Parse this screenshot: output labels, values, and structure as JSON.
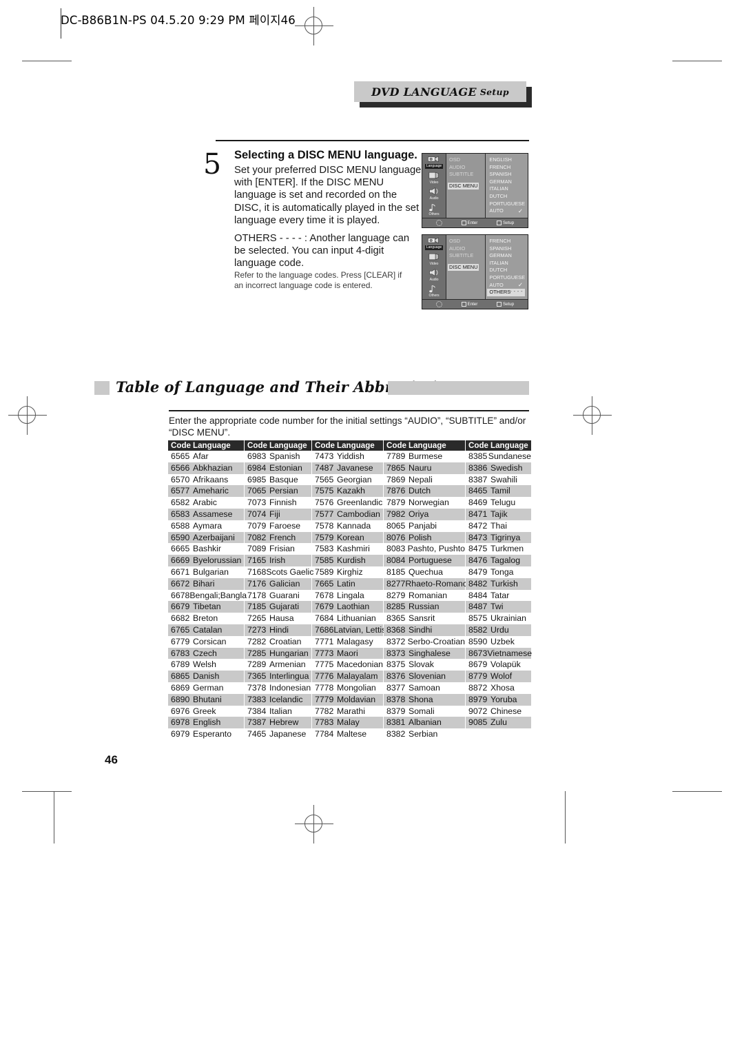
{
  "print_header": {
    "text": "DC-B86B1N-PS  04.5.20 9:29 PM  페이지46"
  },
  "banner": {
    "main": "DVD LANGUAGE",
    "small": "Setup"
  },
  "step": {
    "number": "5",
    "title": "Selecting a DISC MENU language.",
    "body": "Set your preferred DISC MENU language with [ENTER]. If the DISC MENU language is set and recorded on the DISC, it is automatically played in the set language every time it is played.",
    "others_body": "OTHERS - - - - : Another language can be selected. You can input 4-digit language code.",
    "others_note": "Refer to the language codes. Press [CLEAR] if an incorrect language code is entered."
  },
  "osd_screens": [
    {
      "rail": [
        {
          "label": "Language",
          "icon": "camcorder-icon",
          "active": true
        },
        {
          "label": "Video",
          "icon": "film-icon",
          "active": false
        },
        {
          "label": "Audio",
          "icon": "speaker-icon",
          "active": false
        },
        {
          "label": "Others",
          "icon": "note-icon",
          "active": false
        }
      ],
      "middle": [
        {
          "label": "OSD",
          "selected": false
        },
        {
          "label": "AUDIO",
          "selected": false
        },
        {
          "label": "SUBTITLE",
          "selected": false
        },
        {
          "label": "DISC MENU",
          "selected": true
        }
      ],
      "right": [
        {
          "label": "ENGLISH",
          "mark": "",
          "highlight": false
        },
        {
          "label": "FRENCH",
          "mark": "",
          "highlight": false
        },
        {
          "label": "SPANISH",
          "mark": "",
          "highlight": false
        },
        {
          "label": "GERMAN",
          "mark": "",
          "highlight": false
        },
        {
          "label": "ITALIAN",
          "mark": "",
          "highlight": false
        },
        {
          "label": "DUTCH",
          "mark": "",
          "highlight": false
        },
        {
          "label": "PORTUGUESE",
          "mark": "",
          "highlight": false
        },
        {
          "label": "AUTO",
          "mark": "check",
          "highlight": false
        }
      ],
      "footer": {
        "enter": "Enter",
        "setup": "Setup"
      }
    },
    {
      "rail": [
        {
          "label": "Language",
          "icon": "camcorder-icon",
          "active": true
        },
        {
          "label": "Video",
          "icon": "film-icon",
          "active": false
        },
        {
          "label": "Audio",
          "icon": "speaker-icon",
          "active": false
        },
        {
          "label": "Others",
          "icon": "note-icon",
          "active": false
        }
      ],
      "middle": [
        {
          "label": "OSD",
          "selected": false
        },
        {
          "label": "AUDIO",
          "selected": false
        },
        {
          "label": "SUBTITLE",
          "selected": false
        },
        {
          "label": "DISC MENU",
          "selected": true
        }
      ],
      "right": [
        {
          "label": "FRENCH",
          "mark": "",
          "highlight": false
        },
        {
          "label": "SPANISH",
          "mark": "",
          "highlight": false
        },
        {
          "label": "GERMAN",
          "mark": "",
          "highlight": false
        },
        {
          "label": "ITALIAN",
          "mark": "",
          "highlight": false
        },
        {
          "label": "DUTCH",
          "mark": "",
          "highlight": false
        },
        {
          "label": "PORTUGUESE",
          "mark": "",
          "highlight": false
        },
        {
          "label": "AUTO",
          "mark": "check",
          "highlight": false
        },
        {
          "label": "OTHERS",
          "mark": "dashes",
          "highlight": true
        }
      ],
      "footer": {
        "enter": "Enter",
        "setup": "Setup"
      }
    }
  ],
  "section": {
    "title": "Table of Language and Their Abbreviations",
    "intro": "Enter the appropriate code number for the initial settings “AUDIO”, “SUBTITLE” and/or “DISC MENU”."
  },
  "table": {
    "headers": [
      "Code",
      "Language"
    ],
    "columns": [
      [
        [
          "6565",
          "Afar"
        ],
        [
          "6566",
          "Abkhazian"
        ],
        [
          "6570",
          "Afrikaans"
        ],
        [
          "6577",
          "Ameharic"
        ],
        [
          "6582",
          "Arabic"
        ],
        [
          "6583",
          "Assamese"
        ],
        [
          "6588",
          "Aymara"
        ],
        [
          "6590",
          "Azerbaijani"
        ],
        [
          "6665",
          "Bashkir"
        ],
        [
          "6669",
          "Byelorussian"
        ],
        [
          "6671",
          "Bulgarian"
        ],
        [
          "6672",
          "Bihari"
        ],
        [
          "6678",
          "Bengali;Bangla"
        ],
        [
          "6679",
          "Tibetan"
        ],
        [
          "6682",
          "Breton"
        ],
        [
          "6765",
          "Catalan"
        ],
        [
          "6779",
          "Corsican"
        ],
        [
          "6783",
          "Czech"
        ],
        [
          "6789",
          "Welsh"
        ],
        [
          "6865",
          "Danish"
        ],
        [
          "6869",
          "German"
        ],
        [
          "6890",
          "Bhutani"
        ],
        [
          "6976",
          "Greek"
        ],
        [
          "6978",
          "English"
        ],
        [
          "6979",
          "Esperanto"
        ]
      ],
      [
        [
          "6983",
          "Spanish"
        ],
        [
          "6984",
          "Estonian"
        ],
        [
          "6985",
          "Basque"
        ],
        [
          "7065",
          "Persian"
        ],
        [
          "7073",
          "Finnish"
        ],
        [
          "7074",
          "Fiji"
        ],
        [
          "7079",
          "Faroese"
        ],
        [
          "7082",
          "French"
        ],
        [
          "7089",
          "Frisian"
        ],
        [
          "7165",
          "Irish"
        ],
        [
          "7168",
          "Scots Gaelic"
        ],
        [
          "7176",
          "Galician"
        ],
        [
          "7178",
          "Guarani"
        ],
        [
          "7185",
          "Gujarati"
        ],
        [
          "7265",
          "Hausa"
        ],
        [
          "7273",
          "Hindi"
        ],
        [
          "7282",
          "Croatian"
        ],
        [
          "7285",
          "Hungarian"
        ],
        [
          "7289",
          "Armenian"
        ],
        [
          "7365",
          "Interlingua"
        ],
        [
          "7378",
          "Indonesian"
        ],
        [
          "7383",
          "Icelandic"
        ],
        [
          "7384",
          "Italian"
        ],
        [
          "7387",
          "Hebrew"
        ],
        [
          "7465",
          "Japanese"
        ]
      ],
      [
        [
          "7473",
          "Yiddish"
        ],
        [
          "7487",
          "Javanese"
        ],
        [
          "7565",
          "Georgian"
        ],
        [
          "7575",
          "Kazakh"
        ],
        [
          "7576",
          "Greenlandic"
        ],
        [
          "7577",
          "Cambodian"
        ],
        [
          "7578",
          "Kannada"
        ],
        [
          "7579",
          "Korean"
        ],
        [
          "7583",
          "Kashmiri"
        ],
        [
          "7585",
          "Kurdish"
        ],
        [
          "7589",
          "Kirghiz"
        ],
        [
          "7665",
          "Latin"
        ],
        [
          "7678",
          "Lingala"
        ],
        [
          "7679",
          "Laothian"
        ],
        [
          "7684",
          "Lithuanian"
        ],
        [
          "7686",
          "Latvian, Lettish"
        ],
        [
          "7771",
          "Malagasy"
        ],
        [
          "7773",
          "Maori"
        ],
        [
          "7775",
          "Macedonian"
        ],
        [
          "7776",
          "Malayalam"
        ],
        [
          "7778",
          "Mongolian"
        ],
        [
          "7779",
          "Moldavian"
        ],
        [
          "7782",
          "Marathi"
        ],
        [
          "7783",
          "Malay"
        ],
        [
          "7784",
          "Maltese"
        ]
      ],
      [
        [
          "7789",
          "Burmese"
        ],
        [
          "7865",
          "Nauru"
        ],
        [
          "7869",
          "Nepali"
        ],
        [
          "7876",
          "Dutch"
        ],
        [
          "7879",
          "Norwegian"
        ],
        [
          "7982",
          "Oriya"
        ],
        [
          "8065",
          "Panjabi"
        ],
        [
          "8076",
          "Polish"
        ],
        [
          "8083",
          "Pashto, Pushto"
        ],
        [
          "8084",
          "Portuguese"
        ],
        [
          "8185",
          "Quechua"
        ],
        [
          "8277",
          "Rhaeto-Romance"
        ],
        [
          "8279",
          "Romanian"
        ],
        [
          "8285",
          "Russian"
        ],
        [
          "8365",
          "Sansrit"
        ],
        [
          "8368",
          "Sindhi"
        ],
        [
          "8372",
          "Serbo-Croatian"
        ],
        [
          "8373",
          "Singhalese"
        ],
        [
          "8375",
          "Slovak"
        ],
        [
          "8376",
          "Slovenian"
        ],
        [
          "8377",
          "Samoan"
        ],
        [
          "8378",
          "Shona"
        ],
        [
          "8379",
          "Somali"
        ],
        [
          "8381",
          "Albanian"
        ],
        [
          "8382",
          "Serbian"
        ]
      ],
      [
        [
          "8385",
          "Sundanese"
        ],
        [
          "8386",
          "Swedish"
        ],
        [
          "8387",
          "Swahili"
        ],
        [
          "8465",
          "Tamil"
        ],
        [
          "8469",
          "Telugu"
        ],
        [
          "8471",
          "Tajik"
        ],
        [
          "8472",
          "Thai"
        ],
        [
          "8473",
          "Tigrinya"
        ],
        [
          "8475",
          "Turkmen"
        ],
        [
          "8476",
          "Tagalog"
        ],
        [
          "8479",
          "Tonga"
        ],
        [
          "8482",
          "Turkish"
        ],
        [
          "8484",
          "Tatar"
        ],
        [
          "8487",
          "Twi"
        ],
        [
          "8575",
          "Ukrainian"
        ],
        [
          "8582",
          "Urdu"
        ],
        [
          "8590",
          "Uzbek"
        ],
        [
          "8673",
          "Vietnamese"
        ],
        [
          "8679",
          "Volapük"
        ],
        [
          "8779",
          "Wolof"
        ],
        [
          "8872",
          "Xhosa"
        ],
        [
          "8979",
          "Yoruba"
        ],
        [
          "9072",
          "Chinese"
        ],
        [
          "9085",
          "Zulu"
        ]
      ]
    ]
  },
  "page_number": "46",
  "colors": {
    "banner_fill": "#c9c9c9",
    "table_header": "#2a2a2a",
    "table_alt_row": "#c9c9c9",
    "osd_background": "#8d8d8d"
  }
}
